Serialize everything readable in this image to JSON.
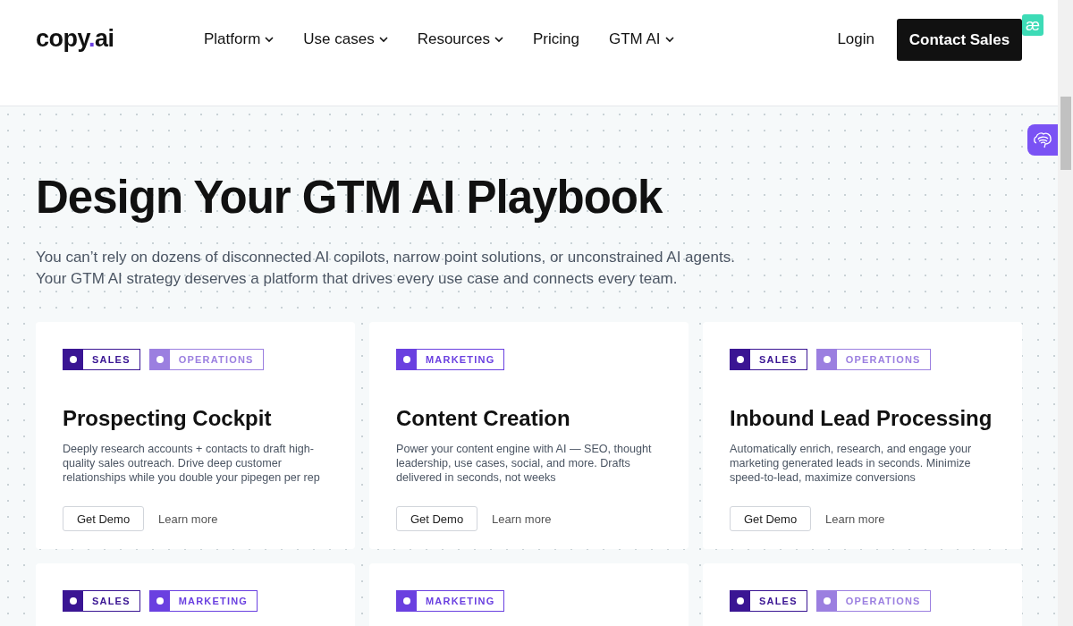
{
  "header": {
    "logo": [
      {
        "text": "copy",
        "accent": false
      },
      {
        "text": ".",
        "accent": true
      },
      {
        "text": "ai",
        "accent": false
      }
    ],
    "nav": [
      {
        "label": "Platform",
        "dropdown": true
      },
      {
        "label": "Use cases",
        "dropdown": true
      },
      {
        "label": "Resources",
        "dropdown": true
      },
      {
        "label": "Pricing",
        "dropdown": false
      },
      {
        "label": "GTM AI",
        "dropdown": true
      }
    ],
    "login": "Login",
    "cta": "Contact Sales",
    "badge": "æ"
  },
  "hero": {
    "title": "Design Your GTM AI Playbook",
    "subtitle": [
      "You can’t rely on dozens of disconnected AI copilots, narrow point solutions, or unconstrained AI agents.",
      "Your GTM AI strategy deserves a platform that drives every use case and connects every team."
    ]
  },
  "cards": [
    {
      "tags": [
        {
          "label": "SALES",
          "color": "#3a1593"
        },
        {
          "label": "OPERATIONS",
          "color": "#9b7fe0"
        }
      ],
      "title": "Prospecting Cockpit",
      "description": "Deeply research accounts + contacts to draft high-quality sales outreach. Drive deep customer relationships while you double your pipegen per rep",
      "primary": "Get Demo",
      "secondary": "Learn more"
    },
    {
      "tags": [
        {
          "label": "MARKETING",
          "color": "#6a40e0"
        }
      ],
      "title": "Content Creation",
      "description": "Power your content engine with AI — SEO, thought leadership, use cases, social, and more. Drafts delivered in seconds, not weeks",
      "primary": "Get Demo",
      "secondary": "Learn more"
    },
    {
      "tags": [
        {
          "label": "SALES",
          "color": "#3a1593"
        },
        {
          "label": "OPERATIONS",
          "color": "#9b7fe0"
        }
      ],
      "title": "Inbound Lead Processing",
      "description": "Automatically enrich, research, and engage your marketing generated leads in seconds. Minimize speed-to-lead, maximize conversions",
      "primary": "Get Demo",
      "secondary": "Learn more"
    },
    {
      "tags": [
        {
          "label": "SALES",
          "color": "#3a1593"
        },
        {
          "label": "MARKETING",
          "color": "#6a40e0"
        }
      ]
    },
    {
      "tags": [
        {
          "label": "MARKETING",
          "color": "#6a40e0"
        }
      ]
    },
    {
      "tags": [
        {
          "label": "SALES",
          "color": "#3a1593"
        },
        {
          "label": "OPERATIONS",
          "color": "#9b7fe0"
        }
      ]
    }
  ]
}
